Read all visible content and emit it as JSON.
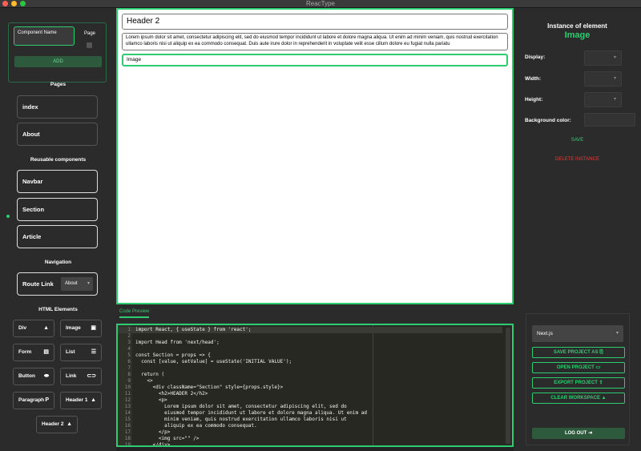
{
  "window": {
    "title": "ReacType"
  },
  "new_component": {
    "name_placeholder": "Component Name",
    "page_label": "Page",
    "add_label": "ADD"
  },
  "pages": {
    "heading": "Pages",
    "items": [
      "index",
      "About"
    ]
  },
  "reusable": {
    "heading": "Reusable components",
    "items": [
      "Navbar",
      "Section",
      "Article"
    ]
  },
  "navigation": {
    "heading": "Navigation",
    "route_label": "Route Link",
    "route_value": "About"
  },
  "html_elements": {
    "heading": "HTML Elements",
    "items": [
      {
        "label": "Div",
        "icon": "▲"
      },
      {
        "label": "Image",
        "icon": "▣"
      },
      {
        "label": "Form",
        "icon": "▤"
      },
      {
        "label": "List",
        "icon": "☰"
      },
      {
        "label": "Button",
        "icon": "⬬"
      },
      {
        "label": "Link",
        "icon": "⊂⊃"
      },
      {
        "label": "Paragraph",
        "icon": "P"
      },
      {
        "label": "Header 1",
        "icon": "▲"
      },
      {
        "label": "Header 2",
        "icon": "▲"
      }
    ]
  },
  "canvas": {
    "header": "Header 2",
    "paragraph": "Lorem ipsum dolor sit amet, consectetur adipiscing elit, sed do eiusmod tempor incididunt ut labore et dolore magna aliqua. Ut enim ad minim veniam, quis nostrud exercitation ullamco laboris nisi ut aliquip ex ea commodo consequat. Duis aute irure dolor in reprehenderit in voluptate velit esse cillum dolore eu fugiat nulla pariatu",
    "image": "Image"
  },
  "code_preview": {
    "tab": "Code Preview",
    "lines": [
      "import React, { useState } from 'react';",
      "",
      "import Head from 'next/head';",
      "",
      "const Section = props => {",
      "  const [value, setValue] = useState('INITIAL VALUE');",
      "",
      "  return (",
      "    <>",
      "      <div className=\"Section\" style={props.style}>",
      "        <h2>HEADER 2</h2>",
      "        <p>",
      "          Lorem ipsum dolor sit amet, consectetur adipiscing elit, sed do",
      "          eiusmod tempor incididunt ut labore et dolore magna aliqua. Ut enim ad",
      "          minim veniam, quis nostrud exercitation ullamco laboris nisi ut",
      "          aliquip ex ea commodo consequat.",
      "        </p>",
      "        <img src=\"\" />",
      "      </div>"
    ]
  },
  "instance": {
    "title": "Instance of element",
    "element": "Image",
    "props": {
      "display": "Display:",
      "width": "Width:",
      "height": "Height:",
      "background": "Background color:"
    },
    "save": "SAVE",
    "delete": "DELETE INSTANCE"
  },
  "project": {
    "framework": "Next.js",
    "save": "SAVE PROJECT AS",
    "open": "OPEN PROJECT",
    "export": "EXPORT PROJECT",
    "clear": "CLEAR WORKSPACE",
    "logout": "LOG OUT"
  },
  "colors": {
    "accent": "#2ecc71",
    "danger": "#e03c3c",
    "panel": "#2b2b2b"
  }
}
